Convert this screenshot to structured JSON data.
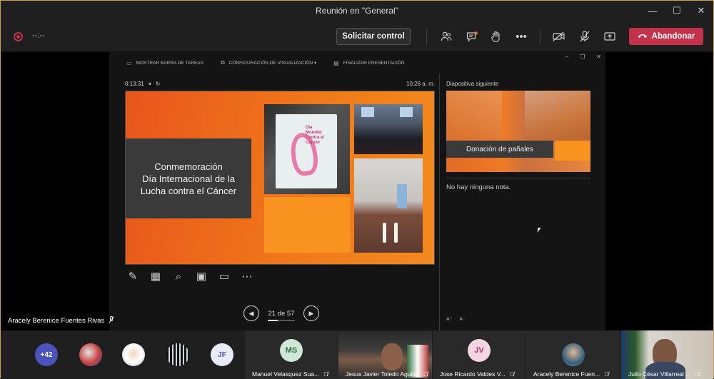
{
  "window": {
    "title": "Reunión en \"General\"",
    "minimize": "—",
    "maximize": "☐",
    "close": "✕"
  },
  "toolbar": {
    "timer": "--:--",
    "request_control": "Solicitar control",
    "leave": "Abandonar"
  },
  "presenter": {
    "top_items": [
      "MOSTRAR BARRA DE TAREAS",
      "CONFIGURACIÓN DE VISUALIZACIÓN ▾",
      "FINALIZAR PRESENTACIÓN"
    ],
    "elapsed": "0:13:31",
    "clock": "10:26 a. m.",
    "slide": {
      "title_lines": [
        "Conmemoración",
        "Día Internacional de la",
        "Lucha contra el Cáncer"
      ],
      "poster_text": "Día Mundial Contra el Cáncer"
    },
    "page": {
      "label": "21 de 57",
      "current": 21,
      "total": 57
    },
    "next_title": "Diapositiva siguiente",
    "next_caption": "Donación de pañales",
    "notes": "No hay ninguna nota."
  },
  "speaker_name": "Aracely Berenice Fuentes Rivas",
  "participants": {
    "overflow": "+42",
    "jf": "JF",
    "tiles": [
      {
        "initials": "MS",
        "name": "Manuel Velasquez Sua...",
        "color": "#cfe7d6",
        "fg": "#2f6e4a"
      },
      {
        "initials": "",
        "name": "Jesus Javier Toledo Aguilar",
        "color": "",
        "fg": ""
      },
      {
        "initials": "JV",
        "name": "Jose Ricardo Valdes V...",
        "color": "#f3d5e4",
        "fg": "#a23d72"
      },
      {
        "initials": "",
        "name": "Aracely Berenice Fuen...",
        "color": "",
        "fg": ""
      },
      {
        "initials": "",
        "name": "Julio César Villarreal ...",
        "color": "",
        "fg": ""
      }
    ]
  }
}
